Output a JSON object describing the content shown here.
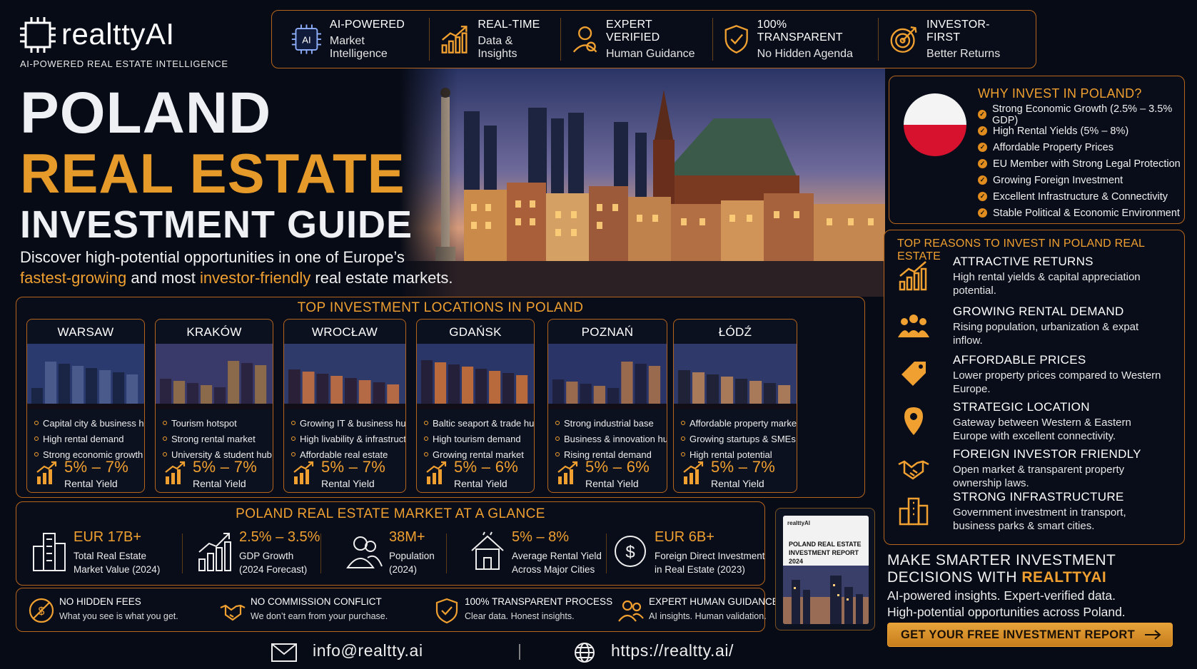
{
  "brand": {
    "name": "realttyAI",
    "tagline": "AI-POWERED REAL ESTATE INTELLIGENCE"
  },
  "badges": [
    {
      "icon": "ai-chip-icon",
      "line1": "AI-POWERED",
      "line2": "Market Intelligence"
    },
    {
      "icon": "growth-chart-icon",
      "line1": "REAL-TIME",
      "line2": "Data & Insights"
    },
    {
      "icon": "expert-user-icon",
      "line1": "EXPERT VERIFIED",
      "line2": "Human Guidance"
    },
    {
      "icon": "shield-check-icon",
      "line1": "100% TRANSPARENT",
      "line2": "No Hidden Agenda"
    },
    {
      "icon": "target-icon",
      "line1": "INVESTOR-FIRST",
      "line2": "Better Returns"
    }
  ],
  "hero": {
    "title_line1": "POLAND",
    "title_line2": "REAL ESTATE",
    "title_line3": "INVESTMENT GUIDE",
    "subtitle_part1": "Discover high-potential opportunities in one of Europe’s",
    "subtitle_highlight1": "fastest-growing",
    "subtitle_part2": "and most",
    "subtitle_highlight2": "investor-friendly",
    "subtitle_part3": "real estate markets."
  },
  "why_invest": {
    "heading": "WHY INVEST IN POLAND?",
    "items": [
      "Strong Economic Growth (2.5% – 3.5% GDP)",
      "High Rental Yields (5% – 8%)",
      "Affordable Property Prices",
      "EU Member with Strong Legal Protection",
      "Growing Foreign Investment",
      "Excellent Infrastructure & Connectivity",
      "Stable Political & Economic Environment"
    ]
  },
  "reasons": {
    "heading": "TOP REASONS TO INVEST IN POLAND REAL ESTATE",
    "items": [
      {
        "icon": "growth-chart-icon",
        "title": "ATTRACTIVE RETURNS",
        "desc": "High rental yields & capital appreciation potential."
      },
      {
        "icon": "people-group-icon",
        "title": "GROWING RENTAL DEMAND",
        "desc": "Rising population, urbanization & expat inflow."
      },
      {
        "icon": "price-tag-icon",
        "title": "AFFORDABLE PRICES",
        "desc": "Lower property prices compared to Western Europe."
      },
      {
        "icon": "location-pin-icon",
        "title": "STRATEGIC LOCATION",
        "desc": "Gateway between Western & Eastern Europe with excellent connectivity."
      },
      {
        "icon": "handshake-icon",
        "title": "FOREIGN INVESTOR FRIENDLY",
        "desc": "Open market & transparent property ownership laws."
      },
      {
        "icon": "buildings-icon",
        "title": "STRONG INFRASTRUCTURE",
        "desc": "Government investment in transport, business parks & smart cities."
      }
    ]
  },
  "locations": {
    "heading": "TOP INVESTMENT LOCATIONS IN POLAND",
    "cities": [
      {
        "name": "WARSAW",
        "points": [
          "Capital city & business hub",
          "High rental demand",
          "Strong economic growth"
        ],
        "yield": "5% – 7%",
        "yield_label": "Rental Yield"
      },
      {
        "name": "KRAKÓW",
        "points": [
          "Tourism hotspot",
          "Strong rental market",
          "University & student hub"
        ],
        "yield": "5% – 7%",
        "yield_label": "Rental Yield"
      },
      {
        "name": "WROCŁAW",
        "points": [
          "Growing IT & business hub",
          "High livability & infrastructure",
          "Affordable real estate"
        ],
        "yield": "5% – 7%",
        "yield_label": "Rental Yield"
      },
      {
        "name": "GDAŃSK",
        "points": [
          "Baltic seaport & trade hub",
          "High tourism demand",
          "Growing rental market"
        ],
        "yield": "5% – 6%",
        "yield_label": "Rental Yield"
      },
      {
        "name": "POZNAŃ",
        "points": [
          "Strong industrial base",
          "Business & innovation hub",
          "Rising rental demand"
        ],
        "yield": "5% – 6%",
        "yield_label": "Rental Yield"
      },
      {
        "name": "ŁÓDŹ",
        "points": [
          "Affordable property market",
          "Growing startups & SMEs",
          "High rental potential"
        ],
        "yield": "5% – 7%",
        "yield_label": "Rental Yield"
      }
    ]
  },
  "glance": {
    "heading": "POLAND REAL ESTATE MARKET AT A GLANCE",
    "stats": [
      {
        "icon": "skyscraper-icon",
        "value": "EUR 17B+",
        "label1": "Total Real Estate",
        "label2": "Market Value (2024)"
      },
      {
        "icon": "growth-chart-icon",
        "value": "2.5% – 3.5%",
        "label1": "GDP Growth",
        "label2": "(2024 Forecast)"
      },
      {
        "icon": "population-icon",
        "value": "38M+",
        "label1": "Population",
        "label2": "(2024)"
      },
      {
        "icon": "house-icon",
        "value": "5% – 8%",
        "label1": "Average Rental Yield",
        "label2": "Across Major Cities"
      },
      {
        "icon": "dollar-coin-icon",
        "value": "EUR 6B+",
        "label1": "Foreign Direct Investment",
        "label2": "in Real Estate (2023)"
      }
    ]
  },
  "guarantees": [
    {
      "icon": "no-fees-icon",
      "title": "NO HIDDEN FEES",
      "desc": "What you see is what you get."
    },
    {
      "icon": "handshake-icon",
      "title": "NO COMMISSION CONFLICT",
      "desc": "We don’t earn from your purchase."
    },
    {
      "icon": "shield-check-icon",
      "title": "100% TRANSPARENT PROCESS",
      "desc": "Clear data. Honest insights."
    },
    {
      "icon": "expert-user-icon",
      "title": "EXPERT HUMAN GUIDANCE",
      "desc": "AI insights. Human validation."
    }
  ],
  "report": {
    "brand": "realttyAI",
    "title": "POLAND REAL ESTATE INVESTMENT REPORT 2024"
  },
  "cta": {
    "line1": "MAKE SMARTER INVESTMENT",
    "line2a": "DECISIONS WITH",
    "line2b": "REALTTYAI",
    "line3": "AI-powered insights. Expert-verified data.",
    "line4": "High-potential opportunities across Poland.",
    "button": "GET YOUR FREE INVESTMENT REPORT"
  },
  "footer": {
    "email": "info@realtty.ai",
    "divider": "|",
    "website": "https://realtty.ai/"
  },
  "colors": {
    "accent": "#f0a030",
    "border": "#b5661c",
    "background": "#070b16",
    "flag_white": "#f4f4f4",
    "flag_red": "#d6122e"
  }
}
